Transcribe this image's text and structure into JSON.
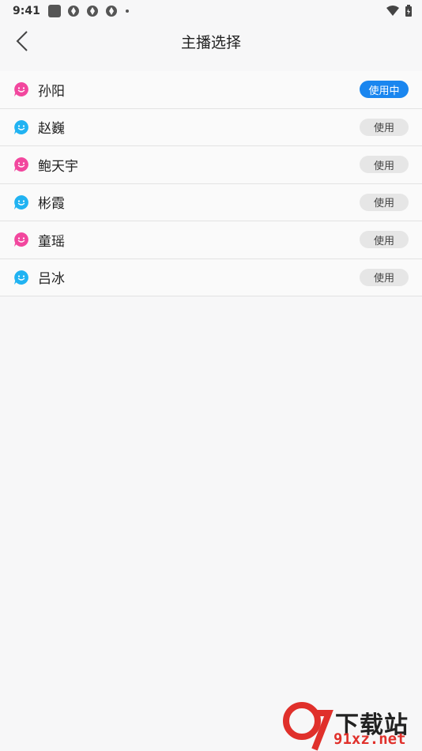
{
  "status": {
    "time": "9:41"
  },
  "header": {
    "title": "主播选择"
  },
  "anchors": [
    {
      "name": "孙阳",
      "button": "使用中",
      "active": true,
      "color": "#f2479e"
    },
    {
      "name": "赵巍",
      "button": "使用",
      "active": false,
      "color": "#21b3f2"
    },
    {
      "name": "鲍天宇",
      "button": "使用",
      "active": false,
      "color": "#f2479e"
    },
    {
      "name": "彬霞",
      "button": "使用",
      "active": false,
      "color": "#21b3f2"
    },
    {
      "name": "童瑶",
      "button": "使用",
      "active": false,
      "color": "#f2479e"
    },
    {
      "name": "吕冰",
      "button": "使用",
      "active": false,
      "color": "#21b3f2"
    }
  ],
  "watermark": {
    "line1": "下载站",
    "line2": "91xz.net"
  }
}
